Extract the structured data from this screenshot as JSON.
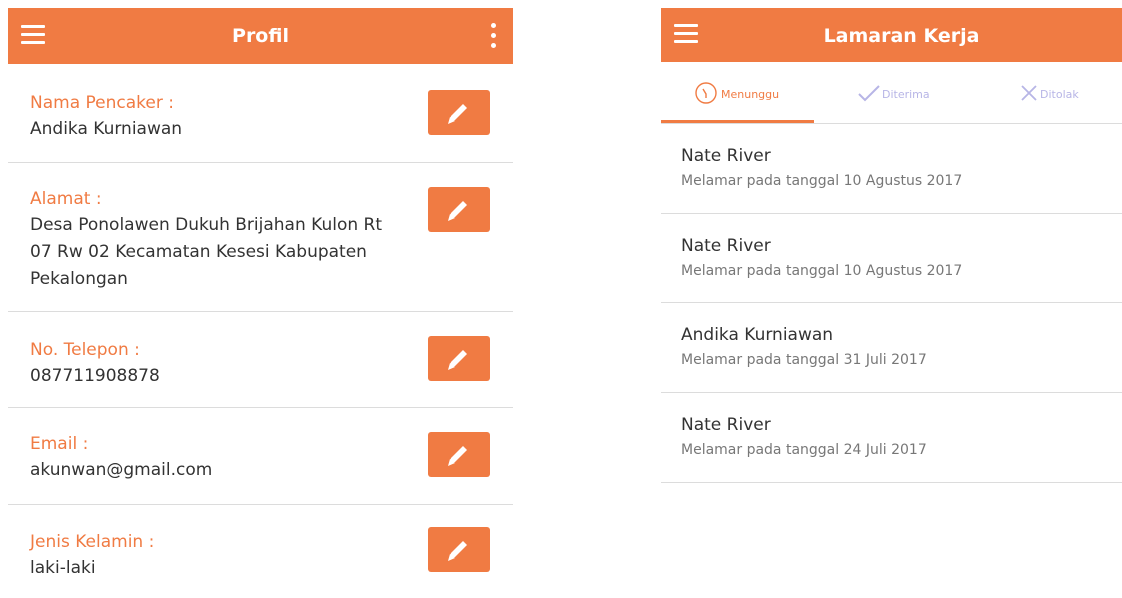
{
  "profile": {
    "title": "Profil",
    "fields": [
      {
        "label": "Nama Pencaker :",
        "value": "Andika Kurniawan"
      },
      {
        "label": "Alamat :",
        "value": "Desa Ponolawen Dukuh Brijahan Kulon Rt 07 Rw 02 Kecamatan Kesesi Kabupaten Pekalongan"
      },
      {
        "label": "No. Telepon :",
        "value": "087711908878"
      },
      {
        "label": "Email :",
        "value": "akunwan@gmail.com"
      },
      {
        "label": "Jenis Kelamin :",
        "value": "laki-laki"
      }
    ]
  },
  "applications": {
    "title": "Lamaran Kerja",
    "tabs": [
      {
        "label": "Menunggu",
        "icon": "clock-icon",
        "active": true
      },
      {
        "label": "Diterima",
        "icon": "check-icon",
        "active": false
      },
      {
        "label": "Ditolak",
        "icon": "x-icon",
        "active": false
      }
    ],
    "items": [
      {
        "name": "Nate River",
        "date": "Melamar pada tanggal 10 Agustus 2017"
      },
      {
        "name": "Nate River",
        "date": "Melamar pada tanggal 10 Agustus 2017"
      },
      {
        "name": "Andika Kurniawan",
        "date": "Melamar pada tanggal 31 Juli 2017"
      },
      {
        "name": "Nate River",
        "date": "Melamar pada tanggal 24 Juli 2017"
      }
    ]
  },
  "colors": {
    "accent": "#F07B43",
    "tab_inactive": "#b7b5e6",
    "divider": "#dcdcdc"
  }
}
